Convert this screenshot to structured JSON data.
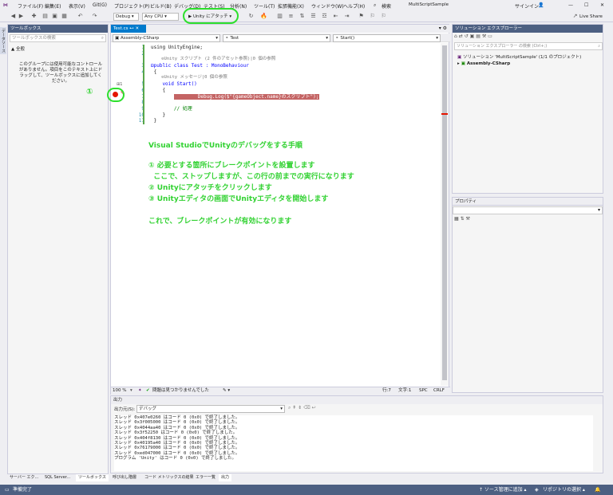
{
  "menu": [
    "ファイル(F)",
    "編集(E)",
    "表示(V)",
    "Git(G)",
    "プロジェクト(P)",
    "ビルド(B)",
    "デバッグ(D)",
    "テスト(S)",
    "分析(N)",
    "ツール(T)",
    "拡張機能(X)",
    "ウィンドウ(W)",
    "ヘルプ(H)"
  ],
  "search_label": "検索",
  "project_name": "MultiScriptSample",
  "signin": "サインイン",
  "liveshare": "Live Share",
  "toolbar": {
    "config": "Debug",
    "platform": "Any CPU",
    "attach_label": "▶ Unity にアタッチ ▾"
  },
  "toolbox": {
    "title": "ツールボックス",
    "search_placeholder": "ツールボックスの検索",
    "group": "▲ 全般",
    "empty_text": "このグループには使用可能なコントロールがありません。項目をこのテキスト上にドラッグして、ツールボックスに追加してください。"
  },
  "left_vertical_tab": "データソース",
  "editor": {
    "tab": "Test.cs",
    "nav_project": "Assembly-CSharp",
    "nav_class": "Test",
    "nav_method": "Start()",
    "lines": [
      {
        "n": "1",
        "text": "using UnityEngine;"
      },
      {
        "n": "2",
        "text": ""
      },
      {
        "n": "",
        "text": "    ⊙Unity スクリプト (2 件のアセット参照)|0 個の参照"
      },
      {
        "n": "3",
        "text": "⊟public class Test : MonoBehaviour"
      },
      {
        "n": "4",
        "text": " {"
      },
      {
        "n": "",
        "text": "    ⊙Unity メッセージ|0 個の参照"
      },
      {
        "n": "5",
        "text": "    void Start()"
      },
      {
        "n": "6",
        "text": "    {"
      },
      {
        "n": "7",
        "text": "        Debug.Log($\"{gameObject.name}のスクリプト\");"
      },
      {
        "n": "8",
        "text": ""
      },
      {
        "n": "9",
        "text": "        // 処理"
      },
      {
        "n": "10",
        "text": "    }"
      },
      {
        "n": "11",
        "text": " }"
      }
    ],
    "zoom": "100 %",
    "issues": "問題は見つかりませんでした",
    "line_pos": "行:7",
    "col_pos": "文字:1",
    "spc": "SPC",
    "crlf": "CRLF"
  },
  "annotation": {
    "title": "Visual StudioでUnityのデバッグをする手順",
    "step1": "① 必要とする箇所にブレークポイントを設置します",
    "step1b": "  ここで、ストップしますが、この行の前までの実行になります",
    "step2": "② Unityにアタッチをクリックします",
    "step3": "③ Unityエディタの画面でUnityエディタを開始します",
    "conclusion": "これで、ブレークポイントが有効になります",
    "marker1": "①",
    "marker2": "②"
  },
  "solution": {
    "title": "ソリューション エクスプローラー",
    "search_placeholder": "ソリューション エクスプローラー の検索 (Ctrl+;)",
    "solution_item": "ソリューション 'MultiScriptSample' (1/1 のプロジェクト)",
    "project_item": "Assembly-CSharp"
  },
  "properties": {
    "title": "プロパティ"
  },
  "output": {
    "title": "出力",
    "source_label": "出力元(S):",
    "source_value": "デバッグ",
    "lines": [
      "スレッド 0x407e0260 はコード 0 (0x0) で終了しました。",
      "スレッド 0x3f005000 はコード 0 (0x0) で終了しました。",
      "スレッド 0x4044aa40 はコード 0 (0x0) で終了しました。",
      "スレッド 0x3f52250 はコード 0 (0x0) で終了しました。",
      "スレッド 0x404f8130 はコード 0 (0x0) で終了しました。",
      "スレッド 0x40195a40 はコード 0 (0x0) で終了しました。",
      "スレッド 0x76179000 はコード 0 (0x0) で終了しました。",
      "スレッド 0xed047000 はコード 0 (0x0) で終了しました。",
      "プログラム 'Unity' はコード 0 (0x0) で終了しました。"
    ]
  },
  "bottom_tabs_left": [
    "サーバー エク...",
    "SQL Server...",
    "ツールボックス"
  ],
  "bottom_tabs_center": [
    "呼び出し階層",
    "コード メトリックスの結果",
    "エラー一覧",
    "出力"
  ],
  "status": {
    "ready": "準備完了",
    "source_control": "↑ ソース管理に追加 ▴",
    "repo": "リポジトリの選択 ▴"
  }
}
